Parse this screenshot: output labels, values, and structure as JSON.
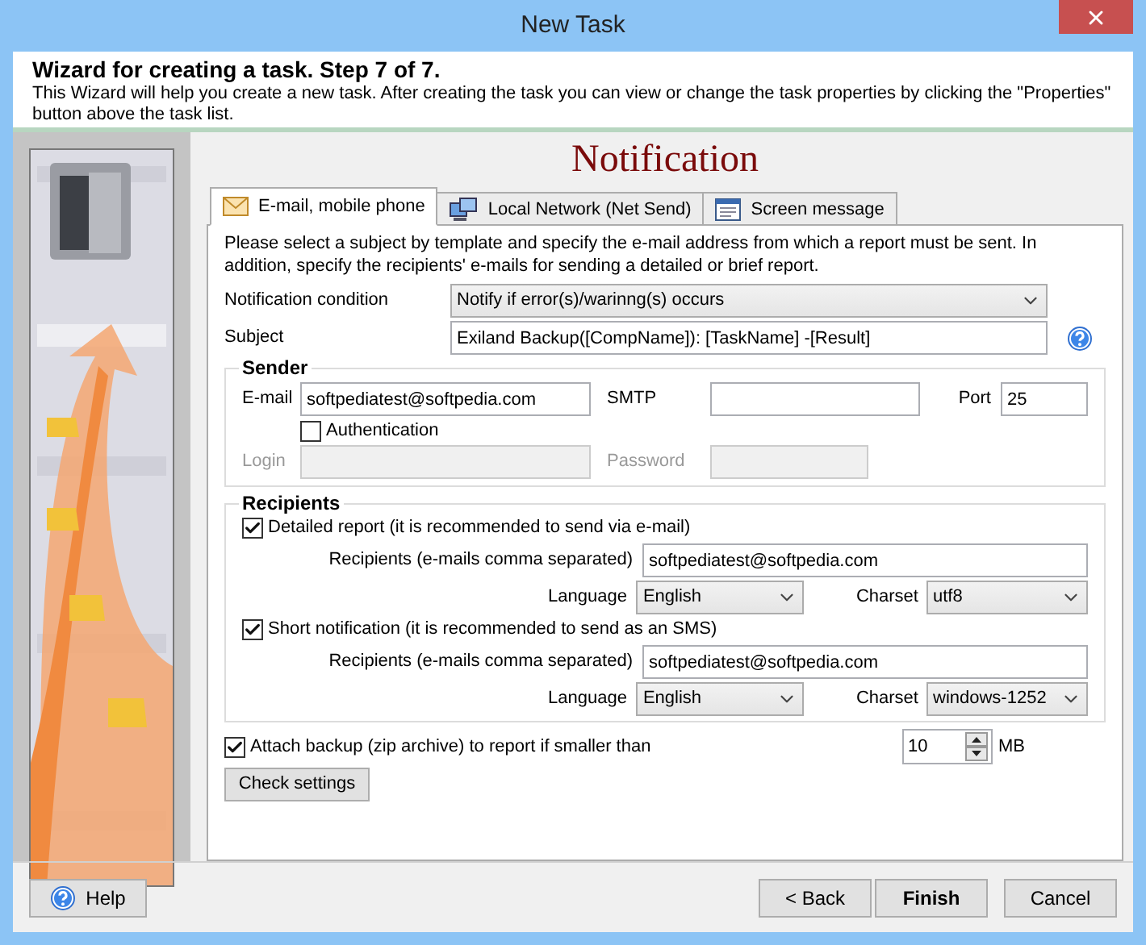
{
  "window": {
    "title": "New Task"
  },
  "header": {
    "title": "Wizard for creating a task. Step 7 of 7.",
    "description": "This Wizard will help you create a new task. After creating the task you can view or change the task properties by clicking the \"Properties\" button above the task list."
  },
  "page_title": "Notification",
  "tabs": [
    {
      "label": "E-mail, mobile phone",
      "selected": true
    },
    {
      "label": "Local Network (Net Send)",
      "selected": false
    },
    {
      "label": "Screen message",
      "selected": false
    }
  ],
  "intro": "Please select a subject by template and specify the e-mail address from which a report must be sent. In addition, specify the recipients' e-mails for sending a detailed or brief report.",
  "condition": {
    "label": "Notification condition",
    "value": "Notify if error(s)/warinng(s) occurs"
  },
  "subject": {
    "label": "Subject",
    "value": "Exiland Backup([CompName]): [TaskName] -[Result]"
  },
  "sender": {
    "title": "Sender",
    "email": {
      "label": "E-mail",
      "value": "softpediatest@softpedia.com"
    },
    "smtp": {
      "label": "SMTP"
    },
    "port": {
      "label": "Port",
      "value": "25"
    },
    "authentication": {
      "label": "Authentication",
      "checked": false
    },
    "login": {
      "label": "Login",
      "disabled": true
    },
    "password": {
      "label": "Password",
      "disabled": true
    }
  },
  "recipients": {
    "title": "Recipients",
    "groups": [
      {
        "label": "Detailed report (it is recommended to send via e-mail)",
        "checked": true,
        "recipients_label": "Recipients (e-mails comma separated)",
        "recipients_value": "softpediatest@softpedia.com",
        "language_label": "Language",
        "language": "English",
        "charset_label": "Charset",
        "charset": "utf8"
      },
      {
        "label": "Short notification (it is recommended to send as an SMS)",
        "checked": true,
        "recipients_label": "Recipients (e-mails comma separated)",
        "recipients_value": "softpediatest@softpedia.com",
        "language_label": "Language",
        "language": "English",
        "charset_label": "Charset",
        "charset": "windows-1252"
      }
    ]
  },
  "attach": {
    "label": "Attach backup (zip archive) to report if smaller than",
    "checked": true,
    "value": "10",
    "unit": "MB"
  },
  "check_button": "Check settings",
  "buttons": {
    "help": "Help",
    "back": "< Back",
    "finish": "Finish",
    "cancel": "Cancel"
  }
}
